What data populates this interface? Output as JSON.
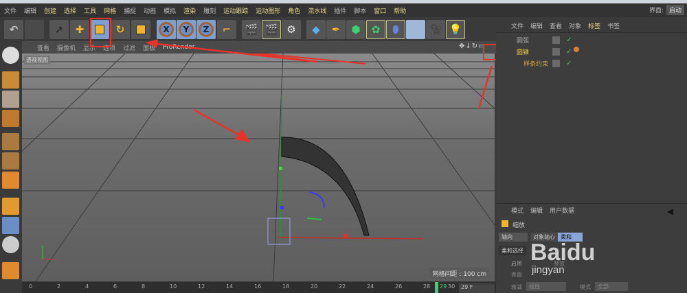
{
  "menu": {
    "items": [
      "文件",
      "编辑",
      "创建",
      "选择",
      "工具",
      "网格",
      "捕捉",
      "动画",
      "模拟",
      "渲染",
      "雕刻",
      "运动跟踪",
      "运动图形",
      "角色",
      "流水线",
      "插件",
      "脚本",
      "窗口",
      "帮助"
    ],
    "layout_label": "界面:",
    "layout_value": "启动"
  },
  "toolbar": {
    "icons": [
      "undo-icon",
      "redo-icon",
      "live-select-icon",
      "move-icon",
      "scale-icon",
      "rotate-icon",
      "recent-tool-icon",
      "x-axis-icon",
      "y-axis-icon",
      "z-axis-icon",
      "coordinate-system-icon",
      "render-view-icon",
      "render-picture-viewer-icon",
      "render-settings-icon",
      "cube-icon",
      "pen-icon",
      "subdivision-icon",
      "array-icon",
      "deformer-icon",
      "floor-icon",
      "camera-icon",
      "light-icon"
    ],
    "x": "X",
    "y": "Y",
    "z": "Z"
  },
  "viewport": {
    "menu": [
      "查看",
      "摄像机",
      "显示",
      "选项",
      "过滤",
      "面板",
      "ProRender"
    ],
    "label": "透视视图",
    "grid_info": "网格间距 : 100 cm"
  },
  "timeline": {
    "ticks": [
      "0",
      "2",
      "4",
      "6",
      "8",
      "10",
      "12",
      "14",
      "16",
      "18",
      "20",
      "22",
      "24",
      "26",
      "28"
    ],
    "current": "29",
    "end": "30",
    "frame_field": "29 F"
  },
  "object_manager": {
    "menu": [
      "文件",
      "编辑",
      "查看",
      "对象",
      "标签",
      "书签"
    ],
    "objects": [
      {
        "name": "圆弧",
        "selected": false
      },
      {
        "name": "圆锥",
        "selected": true
      },
      {
        "name": "样条约束",
        "selected": false
      }
    ]
  },
  "attribute_manager": {
    "menu": [
      "模式",
      "编辑",
      "用户数据"
    ],
    "tool_name": "缩放",
    "tabs": [
      "轴向",
      "对象轴心",
      "柔和"
    ],
    "section": "柔和选择",
    "enable_label": "启用",
    "preview_label": "预览",
    "surface_label": "表面",
    "falloff_label": "衰减",
    "falloff_value": "线性",
    "mode_label": "模式",
    "mode_value": "全部"
  },
  "watermark": {
    "brand": "Baidu",
    "sub": "jingyan"
  },
  "colors": {
    "accent": "#e8d98a",
    "annotation": "#e8332b",
    "selection": "#7fa0cc"
  }
}
